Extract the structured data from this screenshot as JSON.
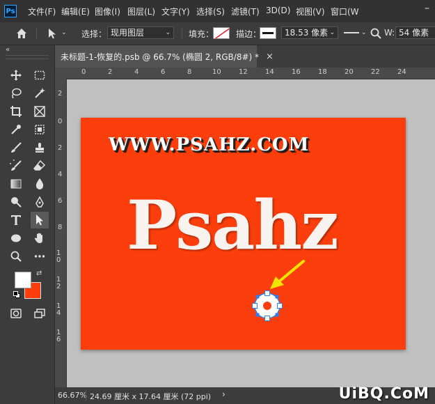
{
  "menubar": {
    "logo": "Ps",
    "items": [
      "文件(F)",
      "编辑(E)",
      "图像(I)",
      "图层(L)",
      "文字(Y)",
      "选择(S)",
      "滤镜(T)",
      "3D(D)",
      "视图(V)",
      "窗口(W"
    ],
    "minimize": "–"
  },
  "options": {
    "select_label": "选择：",
    "select_value": "现用图层",
    "fill_label": "填充：",
    "stroke_label": "描边：",
    "stroke_width": "18.53 像素",
    "w_label": "W:",
    "w_value": "54 像素"
  },
  "document": {
    "tab_title": "未标题-1-恢复的.psb @ 66.7% (椭圆 2, RGB/8#) *",
    "close": "×",
    "hruler_labels": [
      "0",
      "2",
      "4",
      "6",
      "8",
      "10",
      "12",
      "14",
      "16",
      "18",
      "20",
      "22",
      "24"
    ],
    "vruler_labels": [
      "2",
      "0",
      "2",
      "4",
      "6",
      "8",
      "1 0",
      "1 2",
      "1 4",
      "1 6"
    ]
  },
  "canvas": {
    "url_text": "WWW.PSAHZ.COM",
    "big_text": "Psahz",
    "bg_color": "#fb3e0c"
  },
  "status": {
    "zoom": "66.67%",
    "dimensions": "24.69 厘米 x 17.64 厘米 (72 ppi)"
  },
  "watermark": "UiBQ.CoM",
  "colors": {
    "foreground": "#ffffff",
    "background": "#fb3e0c"
  }
}
